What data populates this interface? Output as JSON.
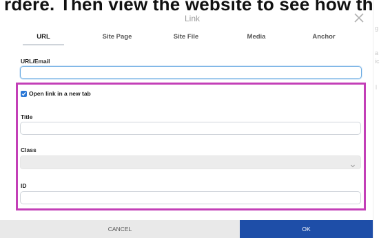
{
  "top_strip_text": "rdere. Then view the website to see how the new link looks in practice.",
  "dialog": {
    "title": "Link",
    "close_glyph": "×"
  },
  "tabs": [
    {
      "label": "URL",
      "active": true
    },
    {
      "label": "Site Page",
      "active": false
    },
    {
      "label": "Site File",
      "active": false
    },
    {
      "label": "Media",
      "active": false
    },
    {
      "label": "Anchor",
      "active": false
    }
  ],
  "url_field": {
    "label": "URL/Email",
    "value": "",
    "placeholder": ""
  },
  "new_tab_checkbox": {
    "label": "Open link in a new tab",
    "checked": true
  },
  "title_field": {
    "label": "Title",
    "value": ""
  },
  "class_field": {
    "label": "Class",
    "selected": ""
  },
  "id_field": {
    "label": "ID",
    "value": ""
  },
  "footer": {
    "cancel_label": "CANCEL",
    "ok_label": "OK"
  },
  "right_edge_glyphs": [
    "g",
    "a",
    "ic",
    "l"
  ],
  "colors": {
    "highlight": "#c33fb7",
    "ok_button": "#1e4ea8",
    "checkbox": "#2a78d6",
    "focus_border": "#67a9e2"
  }
}
